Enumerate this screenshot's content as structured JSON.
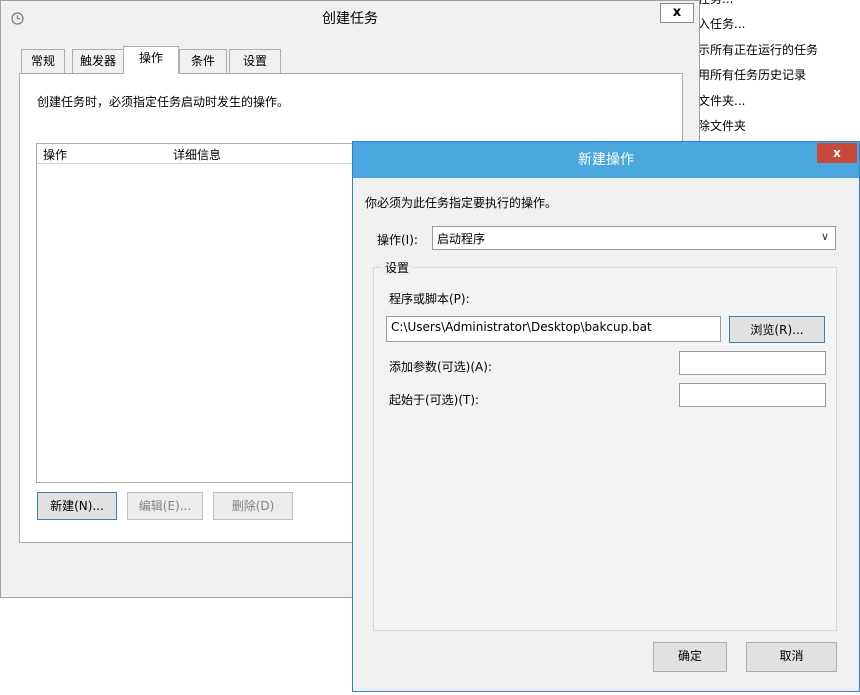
{
  "background_menu": {
    "items": [
      "任务...",
      "入任务...",
      "示所有正在运行的任务",
      "用所有任务历史记录",
      "文件夹...",
      "除文件夹"
    ]
  },
  "create_task": {
    "title": "创建任务",
    "close_glyph": "x",
    "tabs": [
      "常规",
      "触发器",
      "操作",
      "条件",
      "设置"
    ],
    "active_tab": "操作",
    "description": "创建任务时，必须指定任务启动时发生的操作。",
    "list_columns": [
      "操作",
      "详细信息"
    ],
    "buttons": {
      "new": "新建(N)...",
      "edit": "编辑(E)...",
      "delete": "删除(D)"
    }
  },
  "new_action": {
    "title": "新建操作",
    "close_glyph": "x",
    "description": "你必须为此任务指定要执行的操作。",
    "action_label": "操作(I):",
    "action_value": "启动程序",
    "settings_label": "设置",
    "program_label": "程序或脚本(P):",
    "program_value": "C:\\Users\\Administrator\\Desktop\\bakcup.bat",
    "browse": "浏览(R)...",
    "args_label": "添加参数(可选)(A):",
    "args_value": "",
    "start_label": "起始于(可选)(T):",
    "start_value": "",
    "ok": "确定",
    "cancel": "取消"
  },
  "colors": {
    "dialog_titlebar": "#4aa7de",
    "close_red": "#c74a3c",
    "window_bg": "#f0f0f0"
  },
  "icons": [
    "clock-icon",
    "close-icon",
    "chevron-down-icon"
  ]
}
